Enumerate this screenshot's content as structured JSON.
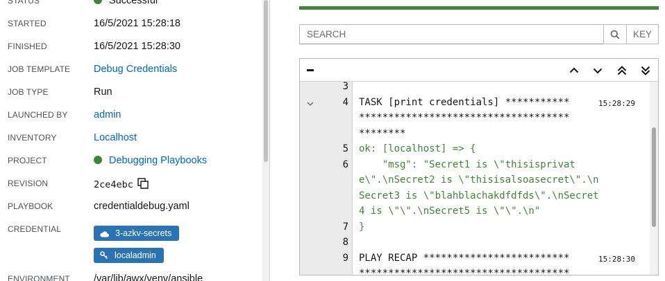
{
  "details": {
    "status": {
      "label": "Status",
      "value": "Successful"
    },
    "started": {
      "label": "Started",
      "value": "16/5/2021 15:28:18"
    },
    "finished": {
      "label": "Finished",
      "value": "16/5/2021 15:28:30"
    },
    "job_template": {
      "label": "Job Template",
      "value": "Debug Credentials"
    },
    "job_type": {
      "label": "Job Type",
      "value": "Run"
    },
    "launched_by": {
      "label": "Launched By",
      "value": "admin"
    },
    "inventory": {
      "label": "Inventory",
      "value": "Localhost"
    },
    "project": {
      "label": "Project",
      "value": "Debugging Playbooks"
    },
    "revision": {
      "label": "Revision",
      "value": "2ce4ebc"
    },
    "playbook": {
      "label": "Playbook",
      "value": "credentialdebug.yaml"
    },
    "credential": {
      "label": "Credential",
      "chips": [
        "3-azkv-secrets",
        "localadmin"
      ]
    },
    "environment": {
      "label": "Environment",
      "value": "/var/lib/awx/venv/ansible"
    }
  },
  "search": {
    "placeholder": "SEARCH",
    "key_label": "KEY"
  },
  "output": {
    "lines": [
      {
        "num": "3",
        "text": "",
        "style": "plain",
        "ts": ""
      },
      {
        "num": "4",
        "text": "TASK [print credentials] ***********",
        "style": "plain",
        "ts": "15:28:29",
        "collapsible": true
      },
      {
        "num": "",
        "text": "************************************",
        "style": "plain",
        "ts": ""
      },
      {
        "num": "",
        "text": "********",
        "style": "plain",
        "ts": ""
      },
      {
        "num": "5",
        "text": "ok: [localhost] => {",
        "style": "ok",
        "ts": ""
      },
      {
        "num": "6",
        "text": "    \"msg\": \"Secret1 is \\\"thisisprivat",
        "style": "ok",
        "ts": ""
      },
      {
        "num": "",
        "text": "e\\\".\\nSecret2 is \\\"thisisalsoasecret\\\".\\n",
        "style": "ok",
        "ts": ""
      },
      {
        "num": "",
        "text": "Secret3 is \\\"blahblachakdfdfds\\\".\\nSecret",
        "style": "ok",
        "ts": ""
      },
      {
        "num": "",
        "text": "4 is \\\"\\\".\\nSecret5 is \\\"\\\".\\n\"",
        "style": "ok",
        "ts": ""
      },
      {
        "num": "7",
        "text": "}",
        "style": "ok",
        "ts": ""
      },
      {
        "num": "8",
        "text": "",
        "style": "plain",
        "ts": ""
      },
      {
        "num": "9",
        "text": "PLAY RECAP *************************",
        "style": "plain",
        "ts": "15:28:30"
      },
      {
        "num": "",
        "text": "************************************",
        "style": "plain",
        "ts": ""
      }
    ]
  },
  "colors": {
    "success": "#3e8635",
    "link": "#0066cc",
    "chip": "#2b74b3"
  }
}
